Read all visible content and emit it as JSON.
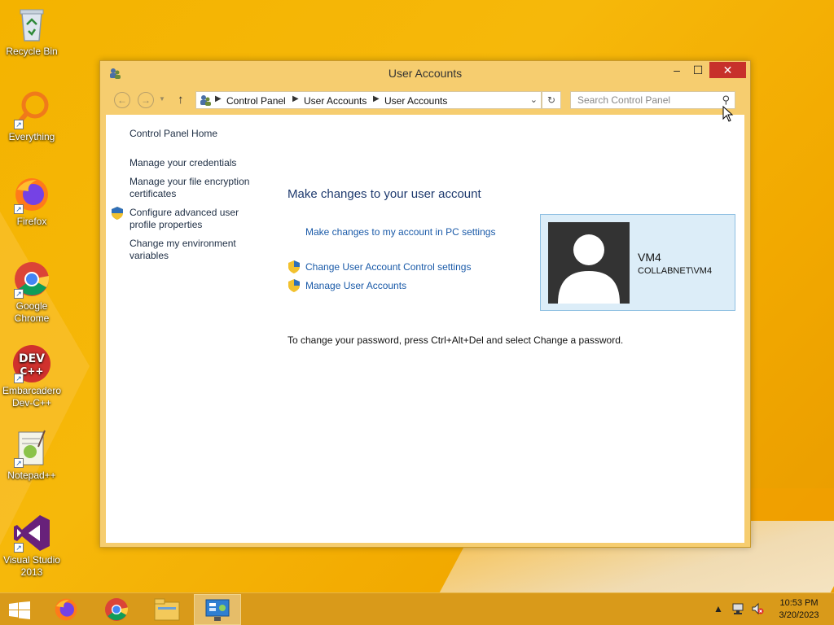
{
  "desktop": {
    "icons": [
      {
        "label": "Recycle Bin",
        "icon": "recycle-bin-icon"
      },
      {
        "label": "Everything",
        "icon": "everything-icon"
      },
      {
        "label": "Firefox",
        "icon": "firefox-icon"
      },
      {
        "label": "Google Chrome",
        "icon": "chrome-icon"
      },
      {
        "label": "Embarcadero Dev-C++",
        "icon": "devcpp-icon",
        "badge": "DEV C++"
      },
      {
        "label": "Notepad++",
        "icon": "notepadpp-icon"
      },
      {
        "label": "Visual Studio 2013",
        "icon": "visual-studio-icon"
      }
    ]
  },
  "window": {
    "title": "User Accounts",
    "controls": {
      "minimize": "–",
      "maximize": "☐",
      "close": "✕"
    },
    "address": {
      "breadcrumbs": [
        "Control Panel",
        "User Accounts",
        "User Accounts"
      ]
    },
    "search": {
      "placeholder": "Search Control Panel"
    },
    "help": "?",
    "sidebar": {
      "home": "Control Panel Home",
      "items": [
        "Manage your credentials",
        "Manage your file encryption certificates",
        "Configure advanced user profile properties",
        "Change my environment variables"
      ]
    },
    "main": {
      "title": "Make changes to your user account",
      "links": [
        "Make changes to my account in PC settings",
        "Change User Account Control settings",
        "Manage User Accounts"
      ],
      "password_note": "To change your password, press Ctrl+Alt+Del and select Change a password."
    },
    "user": {
      "name": "VM4",
      "domain": "COLLABNET\\VM4"
    }
  },
  "taskbar": {
    "time": "10:53 PM",
    "date": "3/20/2023"
  },
  "colors": {
    "accent_link": "#1a5aa8",
    "title_blue": "#1e3a6e",
    "close_red": "#c7312b",
    "window_frame": "#f6cd6f"
  }
}
